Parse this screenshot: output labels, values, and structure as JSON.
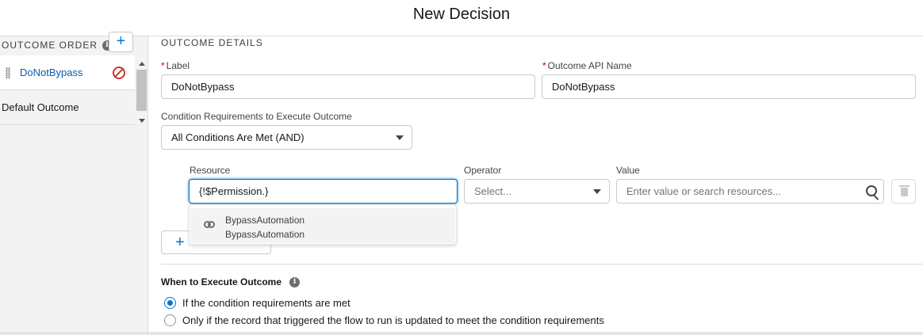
{
  "header": {
    "title": "New Decision"
  },
  "sidebar": {
    "outcome_order_label": "OUTCOME ORDER",
    "add_button": "+",
    "outcomes": [
      {
        "label": "DoNotBypass"
      },
      {
        "label": "Default Outcome"
      }
    ]
  },
  "details": {
    "section_title": "OUTCOME DETAILS",
    "label_field": {
      "label": "Label",
      "required_mark": "*",
      "value": "DoNotBypass"
    },
    "api_name_field": {
      "label": "Outcome API Name",
      "required_mark": "*",
      "value": "DoNotBypass"
    },
    "condition_requirements": {
      "label": "Condition Requirements to Execute Outcome",
      "value": "All Conditions Are Met (AND)"
    },
    "condition": {
      "resource_label": "Resource",
      "resource_value": "{!$Permission.}",
      "operator_label": "Operator",
      "operator_value": "Select...",
      "value_label": "Value",
      "value_placeholder": "Enter value or search resources..."
    },
    "resource_dropdown": [
      {
        "title": "BypassAutomation",
        "subtitle": "BypassAutomation"
      }
    ],
    "add_condition_icon": "+",
    "when_to_execute": {
      "title": "When to Execute Outcome",
      "options": [
        {
          "label": "If the condition requirements are met",
          "checked": true
        },
        {
          "label": "Only if the record that triggered the flow to run is updated to meet the condition requirements",
          "checked": false
        }
      ]
    }
  },
  "colors": {
    "brand": "#0176d3",
    "link": "#0b5cab",
    "danger": "#c23934"
  },
  "icons": [
    "info-icon",
    "plus-icon",
    "drag-handle-icon",
    "ban-icon",
    "chevron-down-icon",
    "search-icon",
    "trash-icon",
    "link-icon"
  ]
}
